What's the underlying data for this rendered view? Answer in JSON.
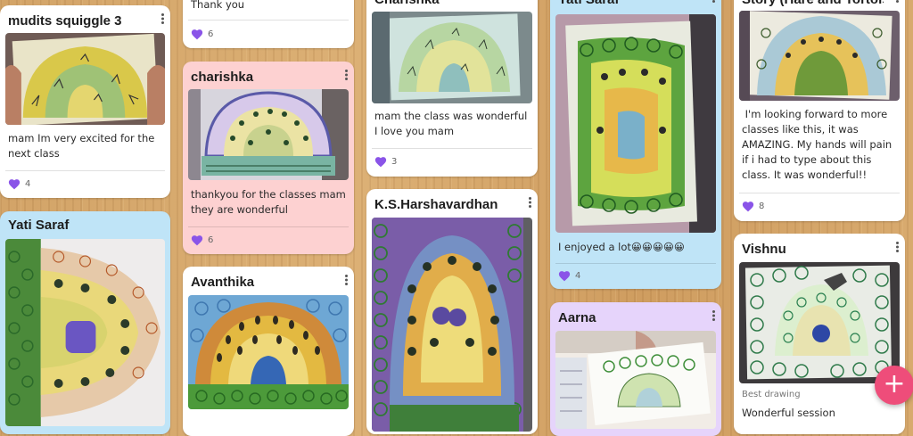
{
  "posts": [
    {
      "title": "mudits squiggle 3",
      "text": "mam Im very excited for the next class",
      "likes": "4"
    },
    {
      "text": "Thank you",
      "likes": "6"
    },
    {
      "title": "charishka",
      "text": "thankyou for the classes mam they are wonderful",
      "likes": "6"
    },
    {
      "title": "Yati Saraf"
    },
    {
      "title": "Avanthika"
    },
    {
      "title": "Charishka",
      "text": "mam the class was wonderful I love you mam",
      "likes": "3"
    },
    {
      "title": "K.S.Harshavardhan"
    },
    {
      "title": "Yati Saraf",
      "text": "I enjoyed a lot😀😀😀😀😀",
      "likes": "4"
    },
    {
      "title": "Aarna"
    },
    {
      "title": "Story (Hare and Tortoise)",
      "text": " I'm looking forward to more classes like this, it was AMAZING. My hands will pain if i had to type about this class. It was wonderful!!",
      "likes": "8"
    },
    {
      "title": "Vishnu",
      "caption": "Best drawing",
      "text": "Wonderful session"
    }
  ],
  "add_button": {
    "label": "+"
  },
  "colors": {
    "white_card": "#ffffff",
    "pink_card": "#fdd1d1",
    "blue_card": "#bfe4f7",
    "lilac_card": "#e6d4fb",
    "heart": "#8a54e8",
    "fab": "#ee4d7a"
  }
}
